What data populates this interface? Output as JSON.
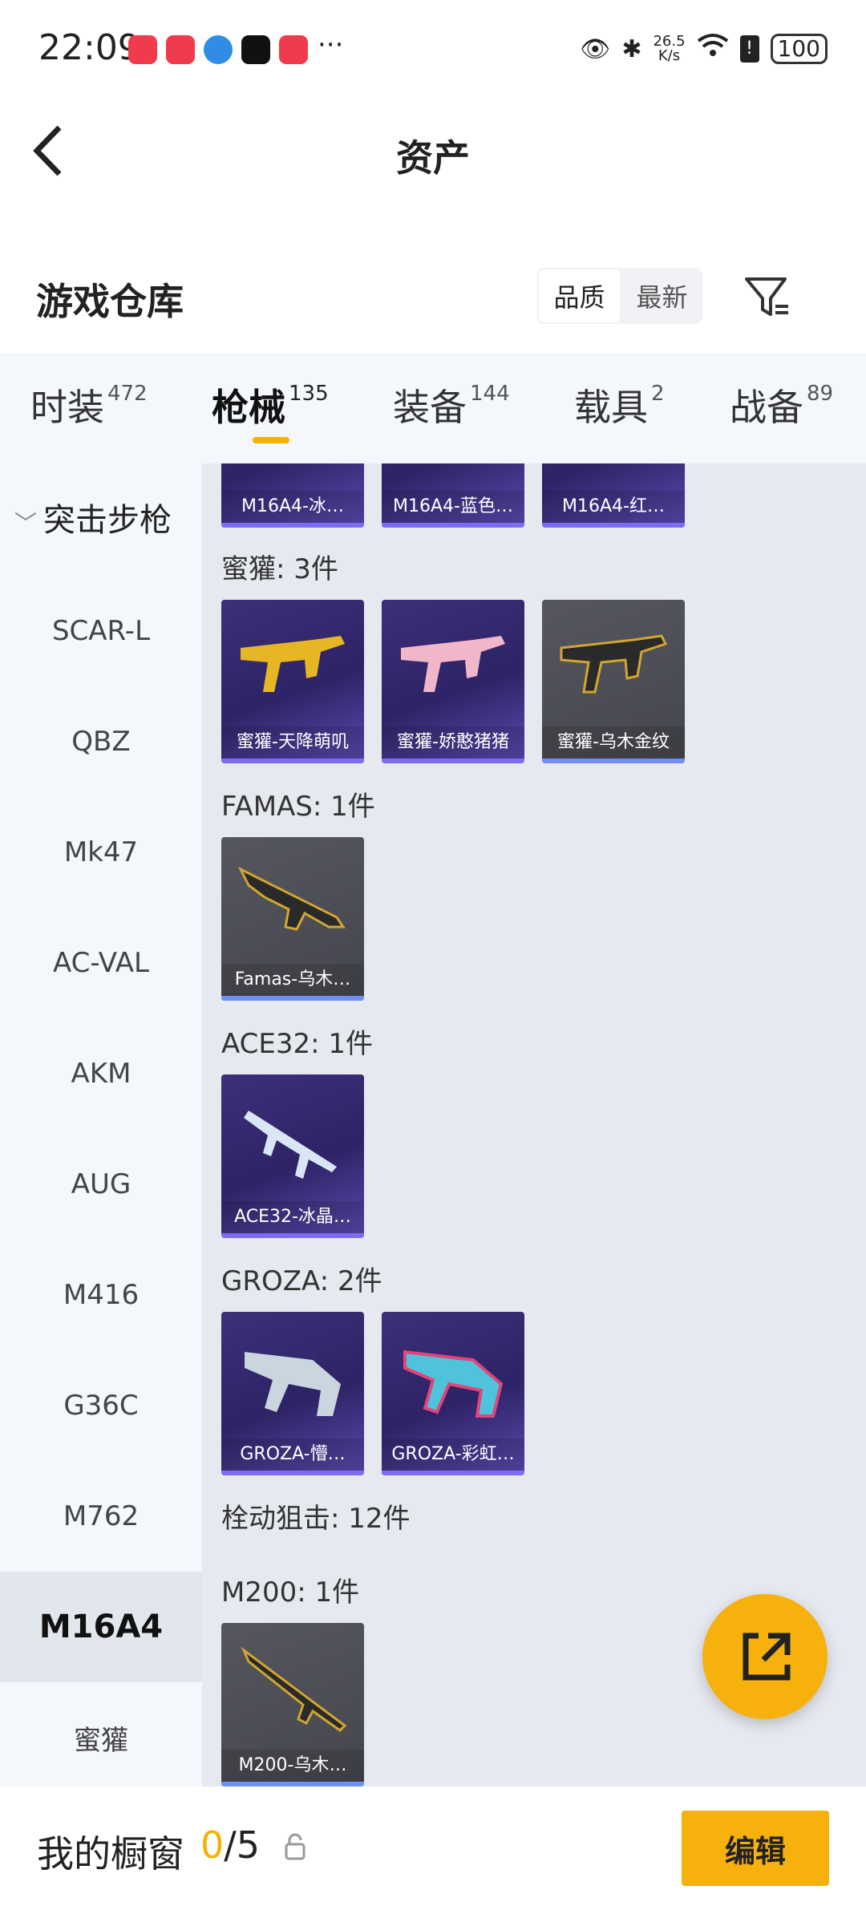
{
  "status_bar": {
    "time": "22:09",
    "more": "···",
    "net_speed": "26.5\nK/s",
    "battery": "100"
  },
  "header": {
    "title": "资产"
  },
  "warehouse": {
    "title": "游戏仓库",
    "sort": [
      "品质",
      "最新"
    ]
  },
  "tabs": [
    {
      "label": "时装",
      "count": "472"
    },
    {
      "label": "枪械",
      "count": "135"
    },
    {
      "label": "装备",
      "count": "144"
    },
    {
      "label": "载具",
      "count": "2"
    },
    {
      "label": "战备",
      "count": "89"
    }
  ],
  "sidebar": {
    "category": "突击步枪",
    "items": [
      "SCAR-L",
      "QBZ",
      "Mk47",
      "AC-VAL",
      "AKM",
      "AUG",
      "M416",
      "G36C",
      "M762",
      "M16A4",
      "蜜獾"
    ],
    "selected": "M16A4"
  },
  "content": {
    "top_row": [
      "M16A4-冰…",
      "M16A4-蓝色…",
      "M16A4-红…"
    ],
    "groups": [
      {
        "header": "蜜獾: 3件",
        "items": [
          "蜜獾-天降萌叽",
          "蜜獾-娇憨猪猪",
          "蜜獾-乌木金纹"
        ]
      },
      {
        "header": "FAMAS: 1件",
        "items": [
          "Famas-乌木…"
        ]
      },
      {
        "header": "ACE32: 1件",
        "items": [
          "ACE32-冰晶…"
        ]
      },
      {
        "header": "GROZA: 2件",
        "items": [
          "GROZA-懵…",
          "GROZA-彩虹…"
        ]
      },
      {
        "header": "栓动狙击: 12件"
      },
      {
        "header": "M200: 1件",
        "items": [
          "M200-乌木…"
        ]
      }
    ]
  },
  "bottom": {
    "label": "我的橱窗",
    "current": "0",
    "total": "/5",
    "edit": "编辑"
  },
  "colors": {
    "accent": "#f7b10c",
    "purple_card": "#2e2366",
    "gray_card": "#4a4b52"
  }
}
